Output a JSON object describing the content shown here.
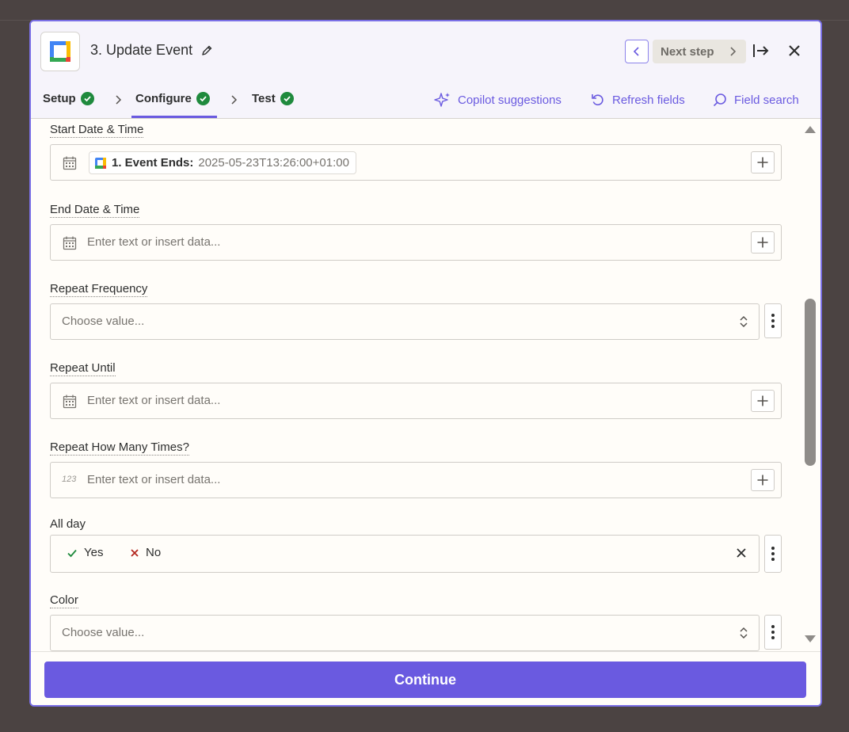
{
  "header": {
    "title": "3. Update Event",
    "next_label": "Next step"
  },
  "tabs": [
    {
      "label": "Setup"
    },
    {
      "label": "Configure"
    },
    {
      "label": "Test"
    }
  ],
  "tools": {
    "copilot": "Copilot suggestions",
    "refresh": "Refresh fields",
    "search": "Field search"
  },
  "fields": {
    "start": {
      "label": "Start Date & Time",
      "pill_label": "1. Event Ends:",
      "pill_value": "2025-05-23T13:26:00+01:00"
    },
    "end": {
      "label": "End Date & Time",
      "placeholder": "Enter text or insert data..."
    },
    "repeat_frequency": {
      "label": "Repeat Frequency",
      "placeholder": "Choose value..."
    },
    "repeat_until": {
      "label": "Repeat Until",
      "placeholder": "Enter text or insert data..."
    },
    "repeat_times": {
      "label": "Repeat How Many Times?",
      "placeholder": "Enter text or insert data...",
      "icon_text": "123"
    },
    "all_day": {
      "label": "All day",
      "yes": "Yes",
      "no": "No"
    },
    "color": {
      "label": "Color",
      "placeholder": "Choose value..."
    }
  },
  "footer": {
    "continue_label": "Continue"
  },
  "colors": {
    "accent": "#6a5ae0",
    "success": "#1f8a3d",
    "danger": "#b3261e"
  }
}
